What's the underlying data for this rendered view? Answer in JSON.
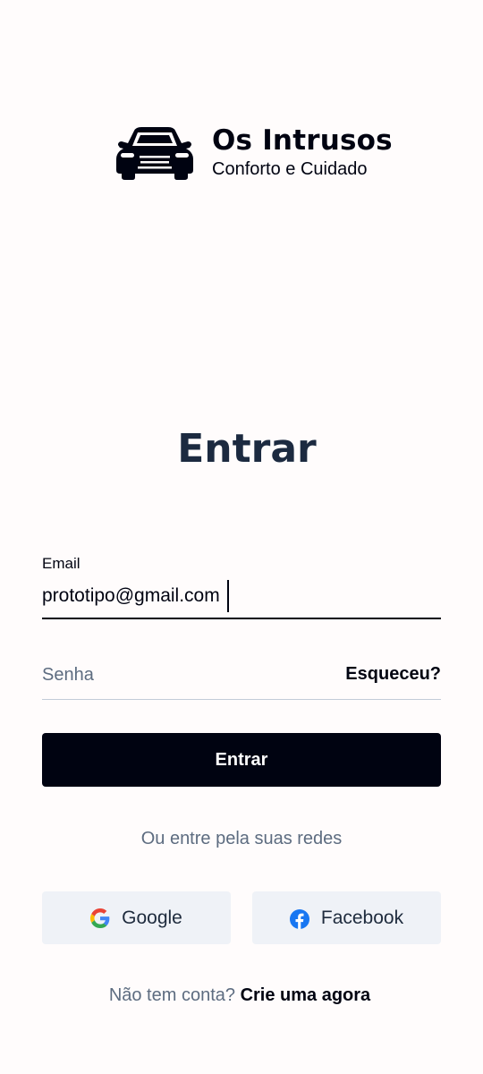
{
  "brand": {
    "name": "Os Intrusos",
    "tagline": "Conforto e Cuidado",
    "logo_icon": "car-icon"
  },
  "page_title": "Entrar",
  "email_field": {
    "label": "Email",
    "value": "prototipo@gmail.com"
  },
  "password_field": {
    "placeholder": "Senha",
    "forgot_label": "Esqueceu?"
  },
  "login_button": {
    "label": "Entrar"
  },
  "social": {
    "caption": "Ou entre pela suas redes",
    "google_label": "Google",
    "google_icon": "google-icon",
    "facebook_label": "Facebook",
    "facebook_icon": "facebook-icon"
  },
  "signup": {
    "question": "Não tem conta?",
    "link": "Crie uma agora"
  },
  "colors": {
    "background": "#fffcfc",
    "primary": "#000311",
    "title": "#1c2a40",
    "muted": "#5d6c80",
    "social_button_bg": "#eff2f7",
    "facebook_blue": "#1877f2"
  }
}
